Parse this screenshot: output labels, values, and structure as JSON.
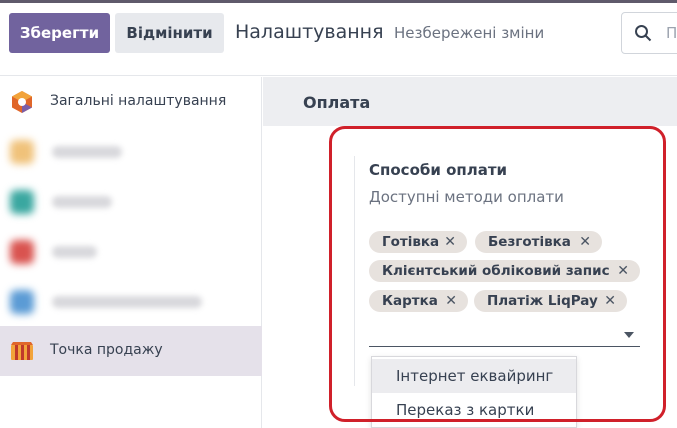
{
  "toolbar": {
    "save_label": "Зберегти",
    "discard_label": "Відмінити"
  },
  "header": {
    "title": "Налаштування",
    "unsaved": "Незбережені зміни"
  },
  "search": {
    "placeholder": "П"
  },
  "sidebar": {
    "items": [
      {
        "label": "Загальні налаштування",
        "icon": "settings-app-icon"
      },
      {
        "label": "",
        "icon": "blurred-app-icon"
      },
      {
        "label": "",
        "icon": "blurred-app-icon"
      },
      {
        "label": "",
        "icon": "blurred-app-icon"
      },
      {
        "label": "",
        "icon": "blurred-app-icon"
      },
      {
        "label": "Точка продажу",
        "icon": "point-of-sale-icon"
      }
    ]
  },
  "section": {
    "title": "Оплата"
  },
  "payment_methods": {
    "title": "Способи оплати",
    "subtitle": "Доступні методи оплати",
    "tags": [
      "Готівка",
      "Безготівка",
      "Клієнтський обліковий запис",
      "Картка",
      "Платіж LiqPay"
    ],
    "remove_glyph": "✕"
  },
  "dropdown": {
    "options": [
      "Інтернет еквайринг",
      "Переказ з картки"
    ]
  },
  "colors": {
    "primary": "#71639e",
    "highlight": "#d0202a",
    "tag_bg": "#e7e2de"
  }
}
